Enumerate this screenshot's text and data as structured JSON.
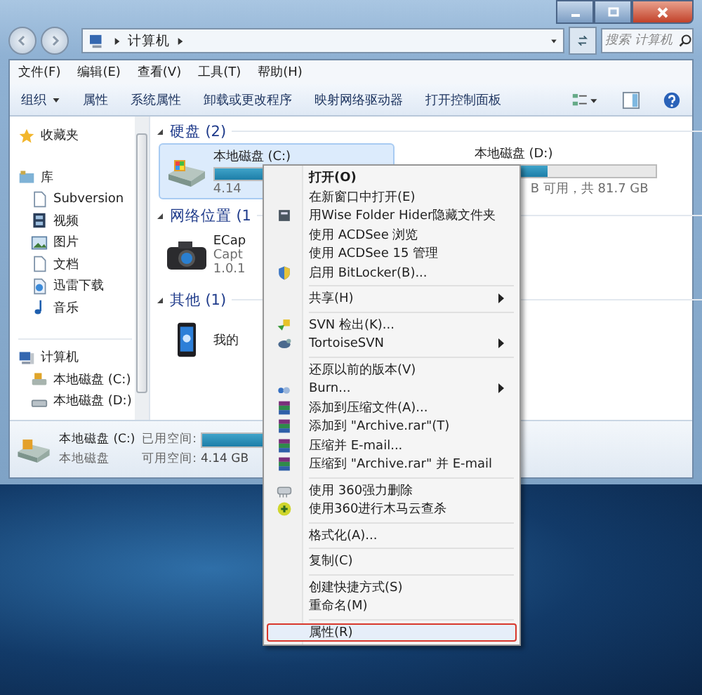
{
  "address_bar": {
    "path": [
      "计算机"
    ],
    "search_placeholder": "搜索 计算机"
  },
  "menu_bar": [
    "文件(F)",
    "编辑(E)",
    "查看(V)",
    "工具(T)",
    "帮助(H)"
  ],
  "toolbar": [
    {
      "label": "组织",
      "dropdown": true
    },
    {
      "label": "属性",
      "dropdown": false
    },
    {
      "label": "系统属性",
      "dropdown": false
    },
    {
      "label": "卸载或更改程序",
      "dropdown": false
    },
    {
      "label": "映射网络驱动器",
      "dropdown": false
    },
    {
      "label": "打开控制面板",
      "dropdown": false
    }
  ],
  "sidebar": {
    "items": [
      {
        "label": "收藏夹"
      },
      {
        "label": "库",
        "children": [
          {
            "label": "Subversion"
          },
          {
            "label": "视频"
          },
          {
            "label": "图片"
          },
          {
            "label": "文档"
          },
          {
            "label": "迅雷下载"
          },
          {
            "label": "音乐"
          }
        ]
      },
      {
        "label": "计算机",
        "children": [
          {
            "label": "本地磁盘 (C:)"
          },
          {
            "label": "本地磁盘 (D:)"
          }
        ]
      }
    ]
  },
  "content": {
    "groups": [
      {
        "heading": "硬盘 (2)",
        "items": [
          {
            "kind": "drive",
            "name": "本地磁盘 (C:)",
            "level": 0.9,
            "detail": "4.14",
            "selected": true
          },
          {
            "kind": "drive",
            "name": "本地磁盘 (D:)",
            "level": 0.4,
            "detail": "B 可用，共 81.7 GB",
            "selected": false
          }
        ]
      },
      {
        "heading": "网络位置 (1",
        "items": [
          {
            "kind": "camera",
            "lines": [
              "ECap",
              "Capt",
              "1.0.1"
            ],
            "selected": false
          }
        ]
      },
      {
        "heading": "其他 (1)",
        "items": [
          {
            "kind": "phone",
            "lines": [
              "我的"
            ],
            "selected": false
          }
        ]
      }
    ]
  },
  "status_bar": {
    "name": "本地磁盘 (C:)",
    "type": "本地磁盘",
    "used_label": "已用空间:",
    "level": 0.9,
    "free_label": "可用空间:",
    "free": "4.14 GB"
  },
  "context_menu": {
    "items": [
      {
        "kind": "item",
        "label": "打开(O)",
        "bold": true,
        "selected": false
      },
      {
        "kind": "item",
        "label": "在新窗口中打开(E)",
        "selected": false
      },
      {
        "kind": "item",
        "label": "用Wise Folder Hider隐藏文件夹",
        "selected": false
      },
      {
        "kind": "item",
        "label": "使用 ACDSee 浏览",
        "selected": false
      },
      {
        "kind": "item",
        "label": "使用 ACDSee 15 管理",
        "selected": false
      },
      {
        "kind": "item",
        "label": "启用 BitLocker(B)...",
        "selected": false
      },
      {
        "kind": "separator"
      },
      {
        "kind": "item",
        "label": "共享(H)",
        "submenu": true,
        "selected": false
      },
      {
        "kind": "separator"
      },
      {
        "kind": "item",
        "label": "SVN 检出(K)...",
        "selected": false
      },
      {
        "kind": "item",
        "label": "TortoiseSVN",
        "submenu": true,
        "selected": false
      },
      {
        "kind": "separator"
      },
      {
        "kind": "item",
        "label": "还原以前的版本(V)",
        "selected": false
      },
      {
        "kind": "item",
        "label": "Burn...",
        "submenu": true,
        "selected": false
      },
      {
        "kind": "item",
        "label": "添加到压缩文件(A)...",
        "selected": false
      },
      {
        "kind": "item",
        "label": "添加到 \"Archive.rar\"(T)",
        "selected": false
      },
      {
        "kind": "item",
        "label": "压缩并 E-mail...",
        "selected": false
      },
      {
        "kind": "item",
        "label": "压缩到 \"Archive.rar\" 并 E-mail",
        "selected": false
      },
      {
        "kind": "separator"
      },
      {
        "kind": "item",
        "label": "使用 360强力删除",
        "selected": false
      },
      {
        "kind": "item",
        "label": "使用360进行木马云查杀",
        "selected": false
      },
      {
        "kind": "separator"
      },
      {
        "kind": "item",
        "label": "格式化(A)...",
        "selected": false
      },
      {
        "kind": "separator"
      },
      {
        "kind": "item",
        "label": "复制(C)",
        "selected": false
      },
      {
        "kind": "separator"
      },
      {
        "kind": "item",
        "label": "创建快捷方式(S)",
        "selected": false
      },
      {
        "kind": "item",
        "label": "重命名(M)",
        "selected": false
      },
      {
        "kind": "separator"
      },
      {
        "kind": "item",
        "label": "属性(R)",
        "selected": true
      }
    ]
  }
}
